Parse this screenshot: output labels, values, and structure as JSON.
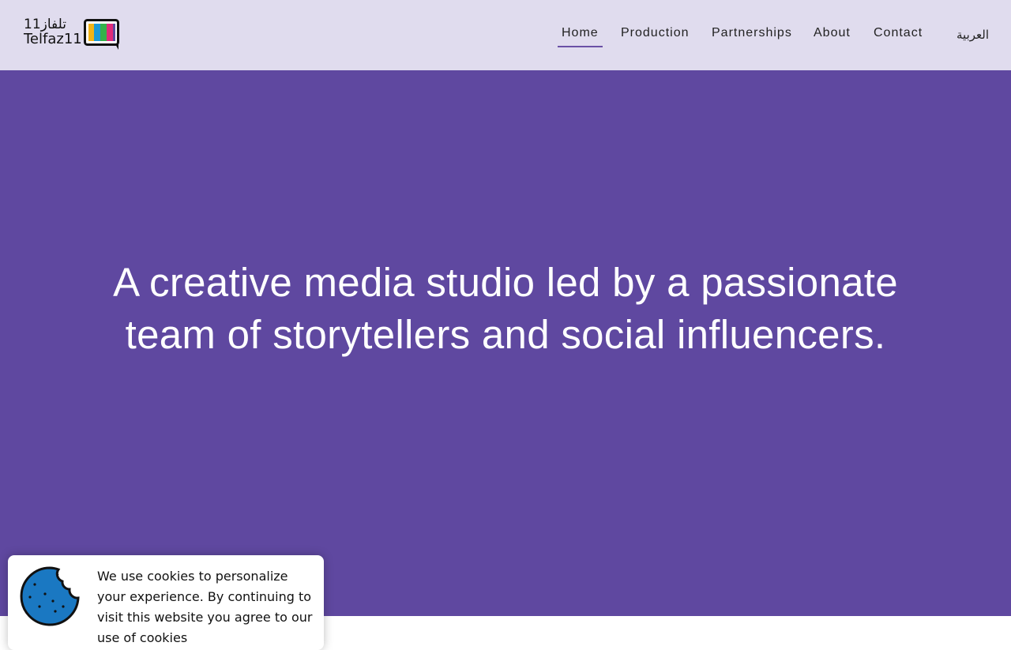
{
  "logo": {
    "arabic_text": "تلفاز11",
    "latin_text": "Telfaz11",
    "icon": "tv-icon",
    "tv_colors": [
      "#f3b416",
      "#1d9ad6",
      "#34b24a",
      "#e02b79",
      "#5f48a0"
    ]
  },
  "nav": {
    "items": [
      {
        "label": "Home",
        "active": true
      },
      {
        "label": "Production",
        "active": false
      },
      {
        "label": "Partnerships",
        "active": false
      },
      {
        "label": "About",
        "active": false
      },
      {
        "label": "Contact",
        "active": false
      }
    ],
    "language_label": "العربية"
  },
  "hero": {
    "line1": "A creative media studio led by a passionate",
    "line2": "team of storytellers and social influencers.",
    "background_color": "#5f48a0"
  },
  "cookie_banner": {
    "icon": "cookie-icon",
    "text": "We use cookies to personalize your experience. By continuing to visit this website you agree to our use of cookies"
  },
  "colors": {
    "header_bg": "#e0dcee",
    "accent": "#6b51a6"
  }
}
